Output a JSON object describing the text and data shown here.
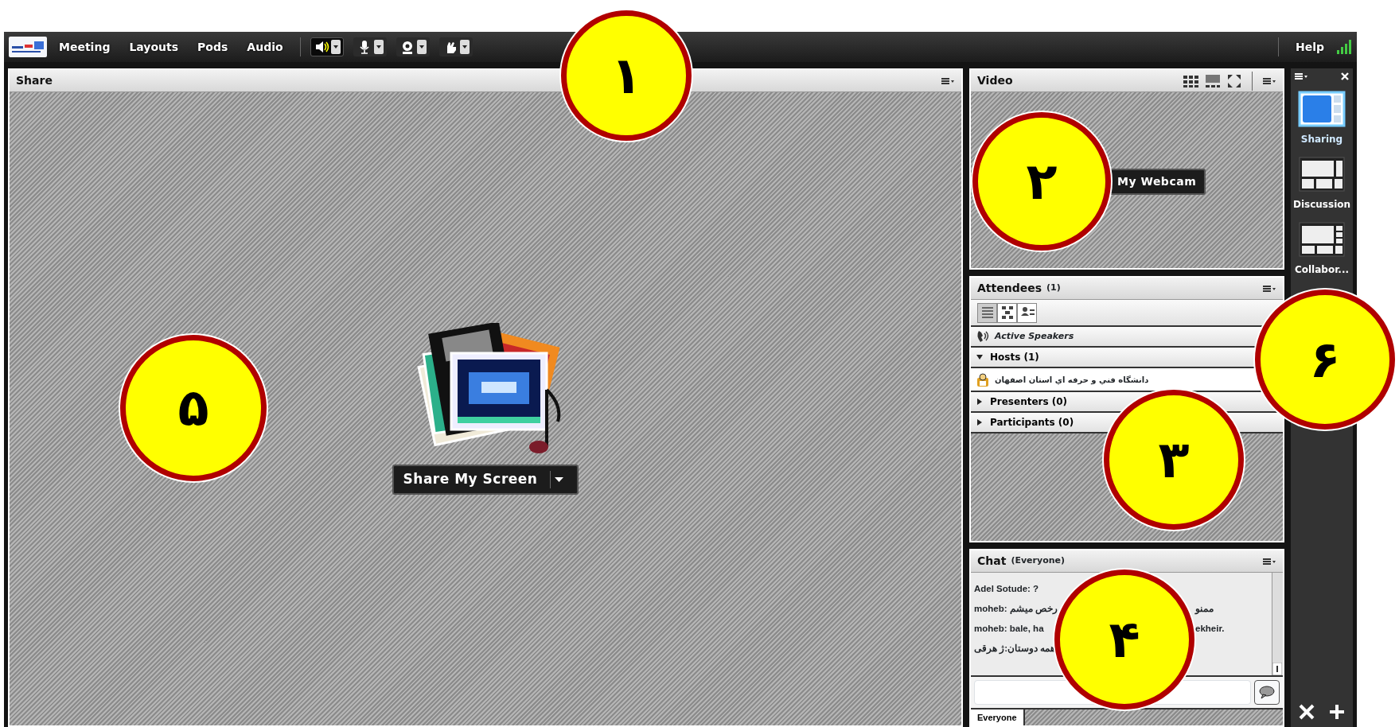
{
  "toolbar": {
    "menus": [
      {
        "label": "Meeting"
      },
      {
        "label": "Layouts"
      },
      {
        "label": "Pods"
      },
      {
        "label": "Audio"
      }
    ],
    "tools": [
      {
        "kind": "speaker",
        "selected": true
      },
      {
        "kind": "microphone",
        "selected": false
      },
      {
        "kind": "webcam",
        "selected": false
      },
      {
        "kind": "hand",
        "selected": false
      }
    ],
    "help": "Help"
  },
  "share_pod": {
    "title": "Share",
    "button": "Share My Screen"
  },
  "video_pod": {
    "title": "Video",
    "webcam_button": "My Webcam"
  },
  "attendees_pod": {
    "title": "Attendees",
    "count": "(1)",
    "views": [
      {
        "kind": "list",
        "selected": true
      },
      {
        "kind": "map",
        "selected": false
      },
      {
        "kind": "detail",
        "selected": false
      }
    ],
    "active_speakers": "Active Speakers",
    "groups": [
      {
        "label": "Hosts (1)",
        "expanded": true,
        "children": [
          {
            "name": "دانشگاه فني و حرفه اي استان اصفهان"
          }
        ]
      },
      {
        "label": "Presenters (0)",
        "expanded": false
      },
      {
        "label": "Participants (0)",
        "expanded": false
      }
    ]
  },
  "chat_pod": {
    "title": "Chat",
    "scope": "(Everyone)",
    "messages": [
      {
        "text": "Adel Sotude: ?"
      },
      {
        "text": "moheb: رخص میشم",
        "tail": "ممنو"
      },
      {
        "text": "moheb: bale, ha",
        "tail": "ekheir."
      },
      {
        "text": "همه دوستان:ژ هرقی"
      }
    ],
    "tab": "Everyone"
  },
  "layouts_bar": {
    "layouts": [
      {
        "label": "Sharing",
        "selected": true
      },
      {
        "label": "Discussion",
        "selected": false
      },
      {
        "label": "Collabor...",
        "selected": false
      }
    ]
  },
  "annotations": [
    {
      "label": "۱"
    },
    {
      "label": "۲"
    },
    {
      "label": "۳"
    },
    {
      "label": "۴"
    },
    {
      "label": "۵"
    },
    {
      "label": "۶"
    }
  ]
}
